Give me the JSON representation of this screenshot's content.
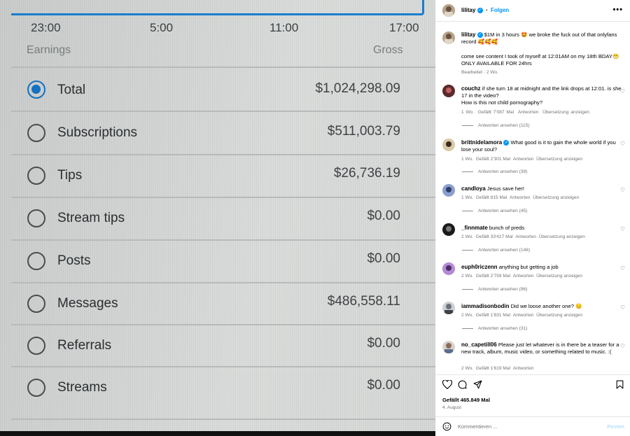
{
  "photo": {
    "chart_times": [
      "23:00",
      "5:00",
      "11:00",
      "17:00"
    ],
    "earnings_label": "Earnings",
    "gross_label": "Gross",
    "rows": [
      {
        "label": "Total",
        "value": "$1,024,298.09",
        "selected": true
      },
      {
        "label": "Subscriptions",
        "value": "$511,003.79",
        "selected": false
      },
      {
        "label": "Tips",
        "value": "$26,736.19",
        "selected": false
      },
      {
        "label": "Stream tips",
        "value": "$0.00",
        "selected": false
      },
      {
        "label": "Posts",
        "value": "$0.00",
        "selected": false
      },
      {
        "label": "Messages",
        "value": "$486,558.11",
        "selected": false
      },
      {
        "label": "Referrals",
        "value": "$0.00",
        "selected": false
      },
      {
        "label": "Streams",
        "value": "$0.00",
        "selected": false
      }
    ],
    "accent_color": "#1572c4"
  },
  "header": {
    "username": "lilitay",
    "separator": "•",
    "follow_label": "Folgen",
    "more_icon": "more-dots-icon"
  },
  "caption": {
    "username": "lilitay",
    "line1": "$1M in 3 hours 🤩 we broke the fuck out of that onlyfans record 🥰🥰🥰",
    "line2": "come see content I took of myself at 12:01AM on my 18th BDAY😁 ONLY AVAILABLE FOR 24hrs",
    "edited": "Bearbeitet · 2 Wo."
  },
  "comments": [
    {
      "user": "couchz",
      "verified": false,
      "text": "if she turn 18 at midnight and the link drops at 12:01. is she 17 in the video?",
      "text2": "How is this not child pornography?",
      "age": "1 Wo.",
      "likes": "Gefällt 7'087 Mal",
      "reply": "Antworten",
      "translate": "Übersetzung anzeigen",
      "replies": "Antworten ansehen (115)"
    },
    {
      "user": "brittnidelamora",
      "verified": true,
      "text": "What good is it to gain the whole world if you lose your soul?",
      "text2": "",
      "age": "1 Wo.",
      "likes": "Gefällt 2'301 Mal",
      "reply": "Antworten",
      "translate": "Übersetzung anzeigen",
      "replies": "Antworten ansehen (39)"
    },
    {
      "user": "candloya",
      "verified": false,
      "text": "Jesus save her!",
      "text2": "",
      "age": "1 Wo.",
      "likes": "Gefällt 815 Mal",
      "reply": "Antworten",
      "translate": "Übersetzung anzeigen",
      "replies": "Antworten ansehen (45)"
    },
    {
      "user": "_finnmate",
      "verified": false,
      "text": "bunch of preds",
      "text2": "",
      "age": "2 Wo.",
      "likes": "Gefällt 33'427 Mal",
      "reply": "Antworten",
      "translate": "Übersetzung anzeigen",
      "replies": "Antworten ansehen (148)"
    },
    {
      "user": "euph0riczenn",
      "verified": false,
      "text": "anything but getting a job",
      "text2": "",
      "age": "2 Wo.",
      "likes": "Gefällt 2'759 Mal",
      "reply": "Antworten",
      "translate": "Übersetzung anzeigen",
      "replies": "Antworten ansehen (96)"
    },
    {
      "user": "iammadisonbodin",
      "verified": false,
      "text": "Did we loose another one? 😔",
      "text2": "",
      "age": "2 Wo.",
      "likes": "Gefällt 1'831 Mal",
      "reply": "Antworten",
      "translate": "Übersetzung anzeigen",
      "replies": "Antworten ansehen (31)"
    },
    {
      "user": "no_capetill06",
      "verified": false,
      "text": "Please just let whatever is in there be a teaser for a new track, album, music video, or something related to music. :(",
      "text2": "",
      "age": "2 Wo.",
      "likes": "Gefällt 1'619 Mal",
      "reply": "Antworten",
      "translate": "",
      "replies": ""
    }
  ],
  "footer": {
    "likes": "Gefällt 465.849 Mal",
    "date": "4. August",
    "comment_placeholder": "Kommentieren ...",
    "post_label": "Posten"
  }
}
